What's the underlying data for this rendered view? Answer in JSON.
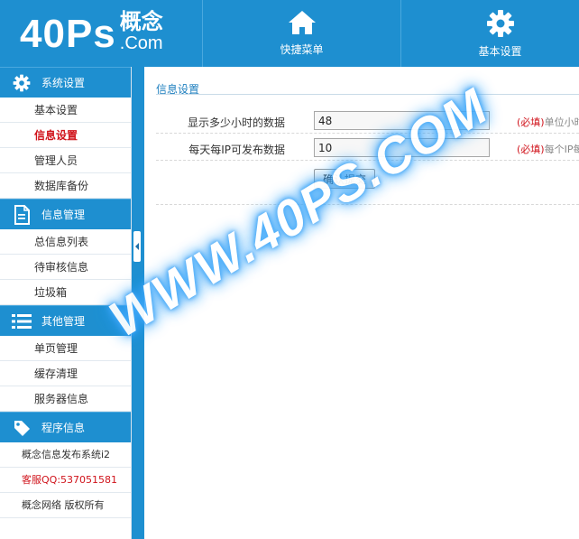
{
  "header": {
    "logo_main": "40Ps",
    "logo_cn": "概念",
    "logo_com": ".Com",
    "nav": [
      {
        "label": "快捷菜单",
        "icon": "home-icon"
      },
      {
        "label": "基本设置",
        "icon": "gear-icon"
      }
    ]
  },
  "sidebar": {
    "groups": [
      {
        "title": "系统设置",
        "icon": "gear-icon",
        "items": [
          {
            "label": "基本设置"
          },
          {
            "label": "信息设置"
          },
          {
            "label": "管理人员"
          },
          {
            "label": "数据库备份"
          }
        ]
      },
      {
        "title": "信息管理",
        "icon": "document-icon",
        "items": [
          {
            "label": "总信息列表"
          },
          {
            "label": "待审核信息"
          },
          {
            "label": "垃圾箱"
          }
        ]
      },
      {
        "title": "其他管理",
        "icon": "list-icon",
        "items": [
          {
            "label": "单页管理"
          },
          {
            "label": "缓存清理"
          },
          {
            "label": "服务器信息"
          }
        ]
      },
      {
        "title": "程序信息",
        "icon": "tag-icon",
        "items": [
          {
            "label": "概念信息发布系统i2"
          },
          {
            "label": "客服QQ:537051581"
          },
          {
            "label": "概念网络 版权所有"
          }
        ]
      }
    ],
    "active_item": "信息设置"
  },
  "main": {
    "section_title": "信息设置",
    "rows": [
      {
        "label": "显示多少小时的数据",
        "value": "48",
        "required": "(必填)",
        "note": "单位小时"
      },
      {
        "label": "每天每IP可发布数据",
        "value": "10",
        "required": "(必填)",
        "note": "每个IP每天"
      }
    ],
    "submit_label": "确认提交"
  },
  "watermark": "WWW.40PS.COM",
  "colors": {
    "brand_blue": "#1e8fd0",
    "required_red": "#d0131b",
    "title_blue": "#1e7fbf"
  }
}
